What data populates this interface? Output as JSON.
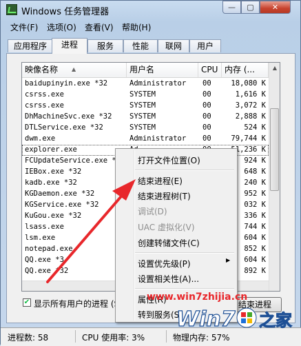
{
  "window": {
    "title": "Windows 任务管理器"
  },
  "caption_buttons": {
    "minimize": "—",
    "maximize": "▢",
    "close": "✕"
  },
  "menubar": {
    "items": [
      "文件(F)",
      "选项(O)",
      "查看(V)",
      "帮助(H)"
    ]
  },
  "tabs": [
    "应用程序",
    "进程",
    "服务",
    "性能",
    "联网",
    "用户"
  ],
  "active_tab": "进程",
  "columns": [
    "映像名称",
    "用户名",
    "CPU",
    "内存 (..."
  ],
  "rows": [
    {
      "name": "baidupinyin.exe *32",
      "user": "Administrator",
      "cpu": "00",
      "mem": "18,080 K"
    },
    {
      "name": "csrss.exe",
      "user": "SYSTEM",
      "cpu": "00",
      "mem": "1,616 K"
    },
    {
      "name": "csrss.exe",
      "user": "SYSTEM",
      "cpu": "00",
      "mem": "3,072 K"
    },
    {
      "name": "DhMachineSvc.exe *32",
      "user": "SYSTEM",
      "cpu": "00",
      "mem": "2,888 K"
    },
    {
      "name": "DTLService.exe *32",
      "user": "SYSTEM",
      "cpu": "00",
      "mem": "524 K"
    },
    {
      "name": "dwm.exe",
      "user": "Administrator",
      "cpu": "00",
      "mem": "79,744 K"
    },
    {
      "name": "explorer.exe",
      "user": "Ad",
      "cpu": "00",
      "mem": "51,236 K"
    },
    {
      "name": "FCUpdateService.exe *",
      "user": "",
      "cpu": "",
      "mem": "924 K"
    },
    {
      "name": "IEBox.exe *32",
      "user": "",
      "cpu": "",
      "mem": "648 K"
    },
    {
      "name": "kadb.exe *32",
      "user": "",
      "cpu": "",
      "mem": "240 K"
    },
    {
      "name": "KGDaemon.exe *32",
      "user": "",
      "cpu": "",
      "mem": "952 K"
    },
    {
      "name": "KGService.exe *32",
      "user": "",
      "cpu": "",
      "mem": "032 K"
    },
    {
      "name": "KuGou.exe *32",
      "user": "",
      "cpu": "",
      "mem": "336 K"
    },
    {
      "name": "lsass.exe",
      "user": "",
      "cpu": "",
      "mem": "744 K"
    },
    {
      "name": "lsm.exe",
      "user": "",
      "cpu": "",
      "mem": "604 K"
    },
    {
      "name": "notepad.exe",
      "user": "",
      "cpu": "",
      "mem": "852 K"
    },
    {
      "name": "QQ.exe *3",
      "user": "",
      "cpu": "",
      "mem": "604 K"
    },
    {
      "name": "QQ.exe *32",
      "user": "",
      "cpu": "",
      "mem": "892 K"
    }
  ],
  "context_menu": {
    "items": [
      {
        "label": "打开文件位置(O)",
        "disabled": false
      },
      {
        "label": "结束进程(E)",
        "disabled": false
      },
      {
        "label": "结束进程树(T)",
        "disabled": false
      },
      {
        "label": "调试(D)",
        "disabled": true
      },
      {
        "label": "UAC 虚拟化(V)",
        "disabled": true
      },
      {
        "label": "创建转储文件(C)",
        "disabled": false
      },
      {
        "label": "设置优先级(P)",
        "disabled": false
      },
      {
        "label": "设置相关性(A)...",
        "disabled": false
      },
      {
        "label": "属性(R)",
        "disabled": false
      },
      {
        "label": "转到服务(S)",
        "disabled": false
      }
    ]
  },
  "show_all_users": {
    "label": "显示所有用户的进程 (S",
    "checked": true
  },
  "end_process_button": "结束进程",
  "status": {
    "processes": "进程数: 58",
    "cpu": "CPU 使用率: 3%",
    "memory": "物理内存: 57%"
  },
  "watermark": {
    "url": "www.win7zhijia.cn",
    "logo_text": "Win7",
    "logo_suffix": "之家"
  },
  "colors": {
    "arrow": "#e8272b",
    "title_bg": "#c9dcf0",
    "close_btn": "#c8432e"
  }
}
